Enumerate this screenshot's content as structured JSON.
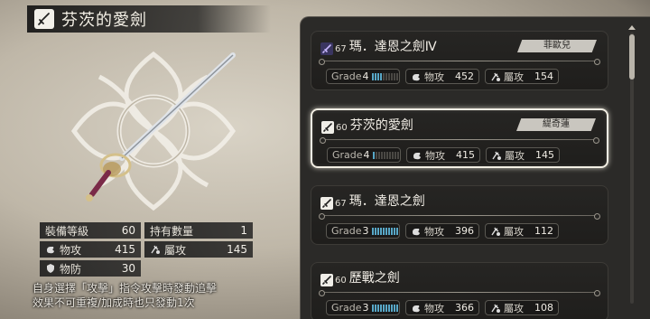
{
  "selected_weapon": {
    "name": "芬茨的愛劍",
    "stats": {
      "equip_level_label": "裝備等級",
      "equip_level_value": "60",
      "owned_count_label": "持有數量",
      "owned_count_value": "1",
      "phys_atk_label": "物攻",
      "phys_atk_value": "415",
      "elem_atk_label": "屬攻",
      "elem_atk_value": "145",
      "phys_def_label": "物防",
      "phys_def_value": "30"
    },
    "description_line1": "自身選擇「攻擊」指令攻擊時發動追擊",
    "description_line2": "效果不可重複/加成時也只發動1次"
  },
  "weapon_list": [
    {
      "level": "67",
      "name": "瑪．達恩之劍Ⅳ",
      "owner": "菲歐兒",
      "grade_label": "Grade",
      "grade": "4",
      "grade_fill": 0.4,
      "phys_label": "物攻",
      "phys": "452",
      "elem_label": "屬攻",
      "elem": "154",
      "icon_style": "purple"
    },
    {
      "level": "60",
      "name": "芬茨的愛劍",
      "owner": "緹奇蓮",
      "grade_label": "Grade",
      "grade": "4",
      "grade_fill": 0.1,
      "phys_label": "物攻",
      "phys": "415",
      "elem_label": "屬攻",
      "elem": "145",
      "icon_style": "white"
    },
    {
      "level": "67",
      "name": "瑪．達恩之劍",
      "owner": "",
      "grade_label": "Grade",
      "grade": "3",
      "grade_fill": 1.0,
      "phys_label": "物攻",
      "phys": "396",
      "elem_label": "屬攻",
      "elem": "112",
      "icon_style": "white"
    },
    {
      "level": "60",
      "name": "歷戰之劍",
      "owner": "",
      "grade_label": "Grade",
      "grade": "3",
      "grade_fill": 1.0,
      "phys_label": "物攻",
      "phys": "366",
      "elem_label": "屬攻",
      "elem": "108",
      "icon_style": "white"
    }
  ],
  "colors": {
    "grade_bar_on": "#58a8c8",
    "selected_border": "#f3efe4"
  }
}
